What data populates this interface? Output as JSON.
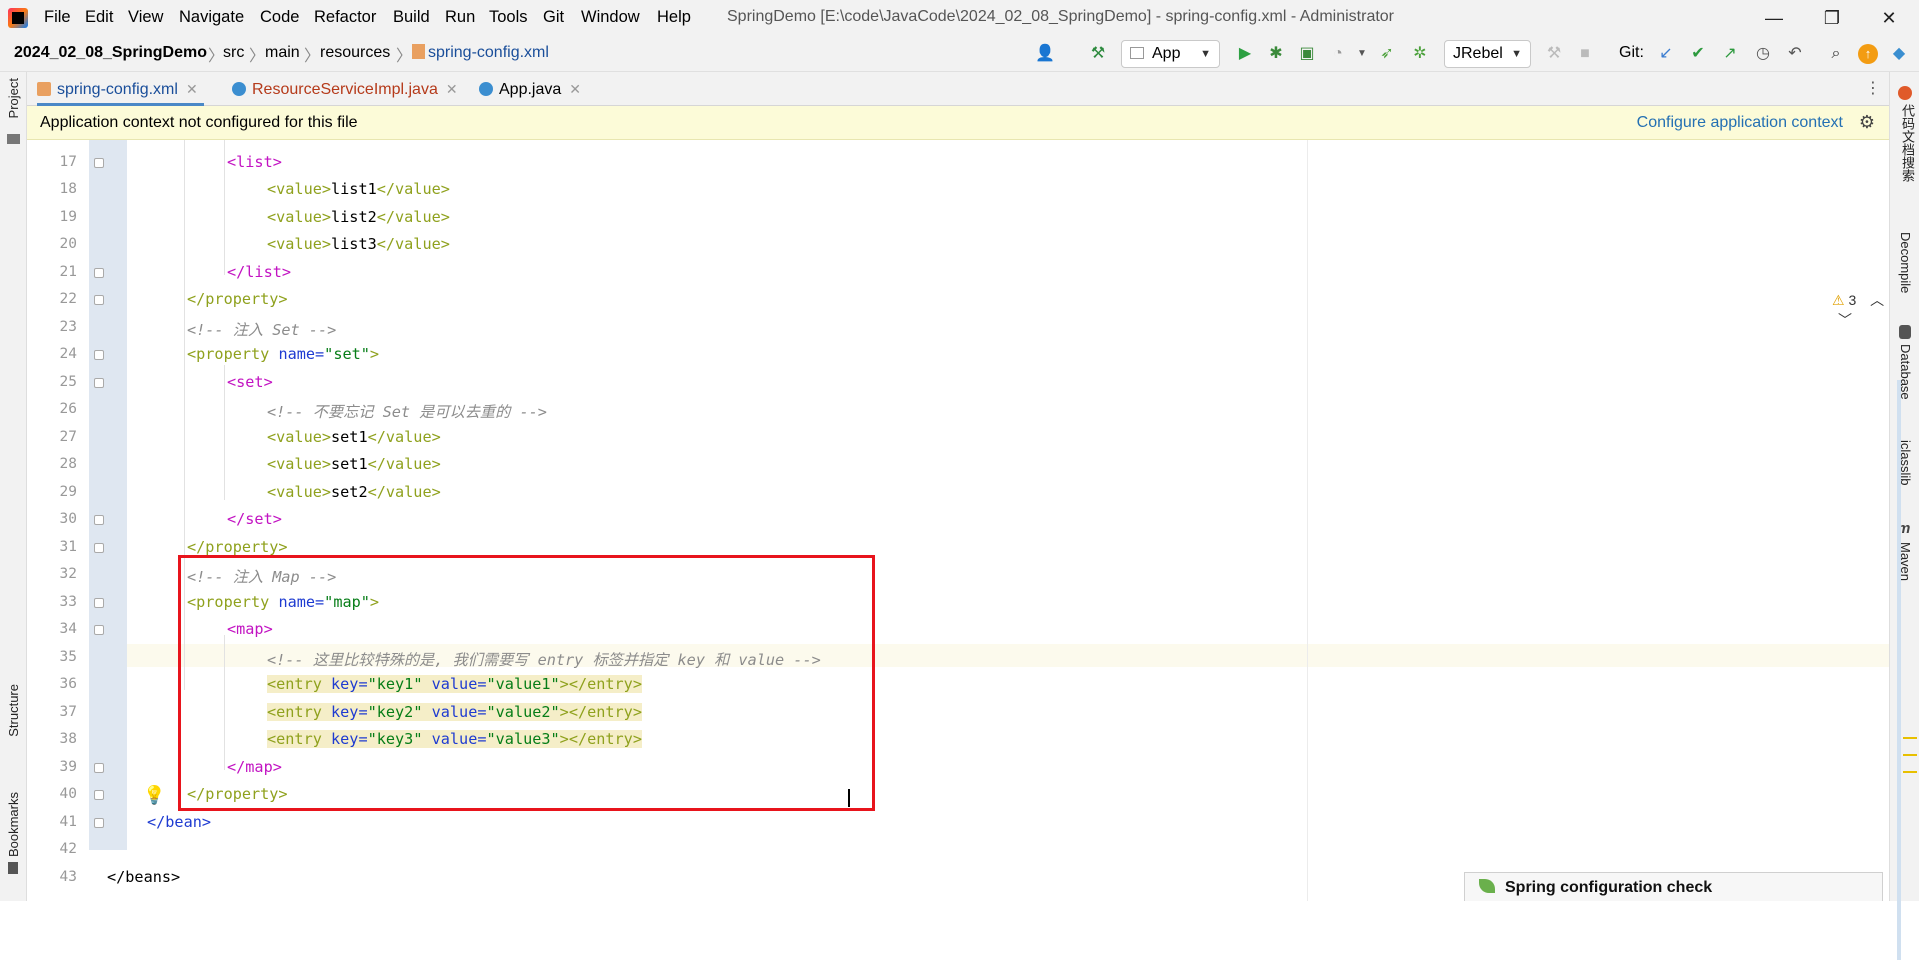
{
  "window": {
    "title": "SpringDemo [E:\\code\\JavaCode\\2024_02_08_SpringDemo] - spring-config.xml - Administrator",
    "minimize": "—",
    "restore": "❐",
    "close": "✕"
  },
  "menu": [
    "File",
    "Edit",
    "View",
    "Navigate",
    "Code",
    "Refactor",
    "Build",
    "Run",
    "Tools",
    "Git",
    "Window",
    "Help"
  ],
  "breadcrumb": [
    "2024_02_08_SpringDemo",
    "src",
    "main",
    "resources",
    "spring-config.xml"
  ],
  "toolbar": {
    "run_config": "App",
    "jrebel": "JRebel",
    "git_label": "Git:"
  },
  "tabs": [
    {
      "label": "spring-config.xml",
      "active": true,
      "icon_color": "#e05a2a"
    },
    {
      "label": "ResourceServiceImpl.java",
      "active": false,
      "icon_color": "#3b8ed0"
    },
    {
      "label": "App.java",
      "active": false,
      "icon_color": "#3b8ed0"
    }
  ],
  "banner": {
    "message": "Application context not configured for this file",
    "action": "Configure application context"
  },
  "inspections": {
    "warnings": "3"
  },
  "left_tools": [
    "Project",
    "Structure",
    "Bookmarks"
  ],
  "right_tools": [
    "代码文档搜索",
    "Decompile",
    "Database",
    "jclasslib",
    "Maven"
  ],
  "editor": {
    "line_numbers": [
      "17",
      "18",
      "19",
      "20",
      "21",
      "22",
      "23",
      "24",
      "25",
      "26",
      "27",
      "28",
      "29",
      "30",
      "31",
      "32",
      "33",
      "34",
      "35",
      "36",
      "37",
      "38",
      "39",
      "40",
      "41",
      "42",
      "43"
    ],
    "lines": {
      "l17": "<list>",
      "l18a": "<value>",
      "l18b": "list1",
      "l18c": "</value>",
      "l19a": "<value>",
      "l19b": "list2",
      "l19c": "</value>",
      "l20a": "<value>",
      "l20b": "list3",
      "l20c": "</value>",
      "l21": "</list>",
      "l22": "</property>",
      "l23": "<!-- 注入 Set -->",
      "l24a": "<property ",
      "l24b": "name",
      "l24c": "=",
      "l24d": "\"set\"",
      "l24e": ">",
      "l25": "<set>",
      "l26": "<!-- 不要忘记 Set 是可以去重的 -->",
      "l27a": "<value>",
      "l27b": "set1",
      "l27c": "</value>",
      "l28a": "<value>",
      "l28b": "set1",
      "l28c": "</value>",
      "l29a": "<value>",
      "l29b": "set2",
      "l29c": "</value>",
      "l30": "</set>",
      "l31": "</property>",
      "l32": "<!-- 注入 Map -->",
      "l33a": "<property ",
      "l33b": "name",
      "l33c": "=",
      "l33d": "\"map\"",
      "l33e": ">",
      "l34": "<map>",
      "l35a": "<!-- 这里比较特殊的是, 我们需要写 entry 标签并指定 key 和 value",
      "l35b": " -->",
      "l36a": "<entry ",
      "l36b": "key",
      "l36c": "=",
      "l36d": "\"key1\"",
      "l36e": " value",
      "l36f": "=",
      "l36g": "\"value1\"",
      "l36h": "></entry>",
      "l37a": "<entry ",
      "l37b": "key",
      "l37c": "=",
      "l37d": "\"key2\"",
      "l37e": " value",
      "l37f": "=",
      "l37g": "\"value2\"",
      "l37h": "></entry>",
      "l38a": "<entry ",
      "l38b": "key",
      "l38c": "=",
      "l38d": "\"key3\"",
      "l38e": " value",
      "l38f": "=",
      "l38g": "\"value3\"",
      "l38h": "></entry>",
      "l39": "</map>",
      "l40": "</property>",
      "l41": "</bean>",
      "l43": "</beans>"
    }
  },
  "popup": {
    "title": "Spring configuration check"
  }
}
